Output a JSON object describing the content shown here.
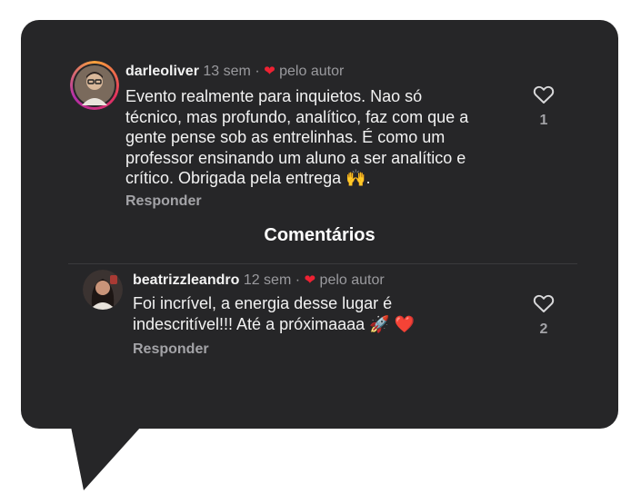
{
  "comments": [
    {
      "username": "darleoliver",
      "time": "13 sem",
      "liked_by_author": "pelo autor",
      "text_lines": [
        "Evento realmente para inquietos. Nao só",
        "técnico, mas profundo, analítico, faz com que a",
        "gente pense sob as entrelinhas. É como um",
        "professor ensinando um aluno a ser analítico e",
        "crítico. Obrigada pela entrega 🙌."
      ],
      "reply_label": "Responder",
      "like_count": "1"
    },
    {
      "username": "beatrizzleandro",
      "time": "12 sem",
      "liked_by_author": "pelo autor",
      "text_lines": [
        "Foi incrível, a energia desse lugar é",
        "indescritível!!! Até a próximaaaa 🚀 ❤️"
      ],
      "reply_label": "Responder",
      "like_count": "2"
    }
  ],
  "section_title": "Comentários",
  "colors": {
    "bubble": "#262628",
    "text": "#f2f2f2",
    "muted": "#9a9a9e",
    "heart": "#ee2233"
  }
}
